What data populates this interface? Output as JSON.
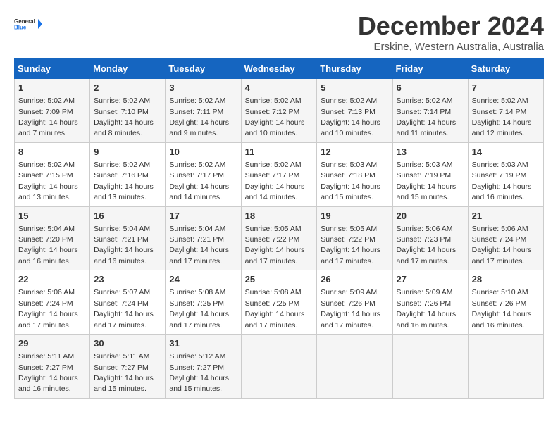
{
  "logo": {
    "line1": "General",
    "line2": "Blue"
  },
  "title": "December 2024",
  "subtitle": "Erskine, Western Australia, Australia",
  "columns": [
    "Sunday",
    "Monday",
    "Tuesday",
    "Wednesday",
    "Thursday",
    "Friday",
    "Saturday"
  ],
  "weeks": [
    [
      {
        "day": "1",
        "sunrise": "5:02 AM",
        "sunset": "7:09 PM",
        "daylight": "14 hours and 7 minutes."
      },
      {
        "day": "2",
        "sunrise": "5:02 AM",
        "sunset": "7:10 PM",
        "daylight": "14 hours and 8 minutes."
      },
      {
        "day": "3",
        "sunrise": "5:02 AM",
        "sunset": "7:11 PM",
        "daylight": "14 hours and 9 minutes."
      },
      {
        "day": "4",
        "sunrise": "5:02 AM",
        "sunset": "7:12 PM",
        "daylight": "14 hours and 10 minutes."
      },
      {
        "day": "5",
        "sunrise": "5:02 AM",
        "sunset": "7:13 PM",
        "daylight": "14 hours and 10 minutes."
      },
      {
        "day": "6",
        "sunrise": "5:02 AM",
        "sunset": "7:14 PM",
        "daylight": "14 hours and 11 minutes."
      },
      {
        "day": "7",
        "sunrise": "5:02 AM",
        "sunset": "7:14 PM",
        "daylight": "14 hours and 12 minutes."
      }
    ],
    [
      {
        "day": "8",
        "sunrise": "5:02 AM",
        "sunset": "7:15 PM",
        "daylight": "14 hours and 13 minutes."
      },
      {
        "day": "9",
        "sunrise": "5:02 AM",
        "sunset": "7:16 PM",
        "daylight": "14 hours and 13 minutes."
      },
      {
        "day": "10",
        "sunrise": "5:02 AM",
        "sunset": "7:17 PM",
        "daylight": "14 hours and 14 minutes."
      },
      {
        "day": "11",
        "sunrise": "5:02 AM",
        "sunset": "7:17 PM",
        "daylight": "14 hours and 14 minutes."
      },
      {
        "day": "12",
        "sunrise": "5:03 AM",
        "sunset": "7:18 PM",
        "daylight": "14 hours and 15 minutes."
      },
      {
        "day": "13",
        "sunrise": "5:03 AM",
        "sunset": "7:19 PM",
        "daylight": "14 hours and 15 minutes."
      },
      {
        "day": "14",
        "sunrise": "5:03 AM",
        "sunset": "7:19 PM",
        "daylight": "14 hours and 16 minutes."
      }
    ],
    [
      {
        "day": "15",
        "sunrise": "5:04 AM",
        "sunset": "7:20 PM",
        "daylight": "14 hours and 16 minutes."
      },
      {
        "day": "16",
        "sunrise": "5:04 AM",
        "sunset": "7:21 PM",
        "daylight": "14 hours and 16 minutes."
      },
      {
        "day": "17",
        "sunrise": "5:04 AM",
        "sunset": "7:21 PM",
        "daylight": "14 hours and 17 minutes."
      },
      {
        "day": "18",
        "sunrise": "5:05 AM",
        "sunset": "7:22 PM",
        "daylight": "14 hours and 17 minutes."
      },
      {
        "day": "19",
        "sunrise": "5:05 AM",
        "sunset": "7:22 PM",
        "daylight": "14 hours and 17 minutes."
      },
      {
        "day": "20",
        "sunrise": "5:06 AM",
        "sunset": "7:23 PM",
        "daylight": "14 hours and 17 minutes."
      },
      {
        "day": "21",
        "sunrise": "5:06 AM",
        "sunset": "7:24 PM",
        "daylight": "14 hours and 17 minutes."
      }
    ],
    [
      {
        "day": "22",
        "sunrise": "5:06 AM",
        "sunset": "7:24 PM",
        "daylight": "14 hours and 17 minutes."
      },
      {
        "day": "23",
        "sunrise": "5:07 AM",
        "sunset": "7:24 PM",
        "daylight": "14 hours and 17 minutes."
      },
      {
        "day": "24",
        "sunrise": "5:08 AM",
        "sunset": "7:25 PM",
        "daylight": "14 hours and 17 minutes."
      },
      {
        "day": "25",
        "sunrise": "5:08 AM",
        "sunset": "7:25 PM",
        "daylight": "14 hours and 17 minutes."
      },
      {
        "day": "26",
        "sunrise": "5:09 AM",
        "sunset": "7:26 PM",
        "daylight": "14 hours and 17 minutes."
      },
      {
        "day": "27",
        "sunrise": "5:09 AM",
        "sunset": "7:26 PM",
        "daylight": "14 hours and 16 minutes."
      },
      {
        "day": "28",
        "sunrise": "5:10 AM",
        "sunset": "7:26 PM",
        "daylight": "14 hours and 16 minutes."
      }
    ],
    [
      {
        "day": "29",
        "sunrise": "5:11 AM",
        "sunset": "7:27 PM",
        "daylight": "14 hours and 16 minutes."
      },
      {
        "day": "30",
        "sunrise": "5:11 AM",
        "sunset": "7:27 PM",
        "daylight": "14 hours and 15 minutes."
      },
      {
        "day": "31",
        "sunrise": "5:12 AM",
        "sunset": "7:27 PM",
        "daylight": "14 hours and 15 minutes."
      },
      null,
      null,
      null,
      null
    ]
  ]
}
